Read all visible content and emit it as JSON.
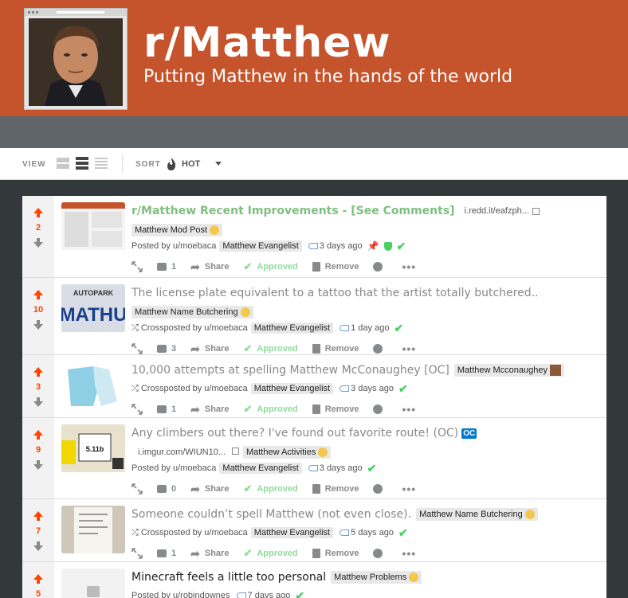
{
  "subreddit": {
    "name": "r/Matthew",
    "tagline": "Putting Matthew in the hands of the world"
  },
  "toolbar": {
    "view_label": "VIEW",
    "sort_label": "SORT",
    "sort_value": "HOT",
    "icons": [
      "card-view-icon",
      "classic-view-icon",
      "compact-view-icon",
      "flame-icon",
      "chevron-down-icon"
    ]
  },
  "colors": {
    "banner": "#c5532b",
    "upvote": "#ff4500",
    "approved": "#8fdc9a",
    "mod_title": "#7fbf7f",
    "oc_badge": "#0079d3"
  },
  "labels": {
    "share": "Share",
    "approved": "Approved",
    "remove": "Remove",
    "more": "•••"
  },
  "posts": [
    {
      "score": "2",
      "title": "r/Matthew Recent Improvements - [See Comments]",
      "domain": "i.redd.it/eafzph...",
      "flair": "Matthew Mod Post",
      "meta_prefix": "Posted by u/moebaca",
      "user_flair": "Matthew Evangelist",
      "time": "3 days ago",
      "comments": "1"
    },
    {
      "score": "10",
      "title": "The license plate equivalent to a tattoo that the artist totally butchered..",
      "flair": "Matthew Name Butchering",
      "meta_prefix": "Crossposted by u/moebaca",
      "user_flair": "Matthew Evangelist",
      "time": "1 day ago",
      "comments": "3"
    },
    {
      "score": "3",
      "title": "10,000 attempts at spelling Matthew McConaughey [OC]",
      "flair": "Matthew Mcconaughey",
      "meta_prefix": "Crossposted by u/moebaca",
      "user_flair": "Matthew Evangelist",
      "time": "3 days ago",
      "comments": "1"
    },
    {
      "score": "9",
      "title": "Any climbers out there? I've found out favorite route! (OC)",
      "oc": "OC",
      "domain": "i.imgur.com/WIUN10...",
      "flair": "Matthew Activities",
      "meta_prefix": "Posted by u/moebaca",
      "user_flair": "Matthew Evangelist",
      "time": "3 days ago",
      "comments": "0",
      "thumb_text": "5.11b"
    },
    {
      "score": "7",
      "title": "Someone couldn’t spell Matthew (not even close).",
      "flair": "Matthew Name Butchering",
      "meta_prefix": "Crossposted by u/moebaca",
      "user_flair": "Matthew Evangelist",
      "time": "5 days ago",
      "comments": "1"
    },
    {
      "score": "5",
      "title": "Minecraft feels a little too personal",
      "flair": "Matthew Problems",
      "meta_prefix": "Posted by u/robindownes",
      "time": "7 days ago"
    }
  ],
  "thumb_texts": {
    "plate_top": "AUTOPARK",
    "plate": "MATHU"
  }
}
